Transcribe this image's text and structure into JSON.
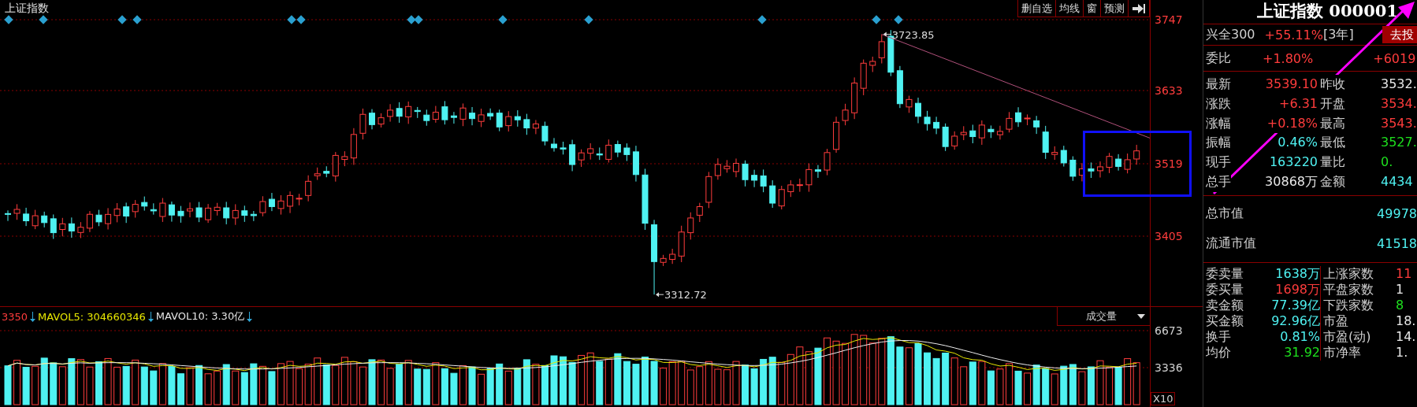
{
  "chart_title": "上证指数",
  "toolbar": [
    {
      "label": "删自选"
    },
    {
      "label": "均线"
    },
    {
      "label": "窗"
    },
    {
      "label": "预测"
    }
  ],
  "price_axis": [
    "3747",
    "3633",
    "3519",
    "3405"
  ],
  "annotations": {
    "high": "3723.85",
    "low": "3312.72"
  },
  "volume": {
    "indicators": [
      {
        "text": "3350",
        "color": "#ff3c3c"
      },
      {
        "text": "MAVOL5: 304660346",
        "color": "#e8e800"
      },
      {
        "text": "MAVOL10: 3.30亿",
        "color": "#e6e6e6"
      }
    ],
    "selector": "成交量",
    "axis": [
      "6673",
      "3336"
    ],
    "multiplier": "X10"
  },
  "quote": {
    "title": "上证指数 000001",
    "promo": {
      "name": "兴全300",
      "return": "+55.11%",
      "period": "[3年]",
      "button": "去投"
    },
    "ratio": {
      "label": "委比",
      "value": "+1.80%",
      "amount": "+6019"
    },
    "rows": [
      [
        {
          "label": "最新",
          "value": "3539.10",
          "color": "#ff3c3c"
        },
        {
          "label": "昨收",
          "value": "3532.",
          "color": "#e8e8e8"
        }
      ],
      [
        {
          "label": "涨跌",
          "value": "+6.31",
          "color": "#ff3c3c"
        },
        {
          "label": "开盘",
          "value": "3534.",
          "color": "#ff3c3c"
        }
      ],
      [
        {
          "label": "涨幅",
          "value": "+0.18%",
          "color": "#ff3c3c"
        },
        {
          "label": "最高",
          "value": "3543.",
          "color": "#ff3c3c"
        }
      ],
      [
        {
          "label": "振幅",
          "value": "0.46%",
          "color": "#4ff2f2"
        },
        {
          "label": "最低",
          "value": "3527.",
          "color": "#1ee01e"
        }
      ],
      [
        {
          "label": "现手",
          "value": "163220",
          "color": "#4ff2f2"
        },
        {
          "label": "量比",
          "value": "0.",
          "color": "#1ee01e"
        }
      ],
      [
        {
          "label": "总手",
          "value": "30868万",
          "color": "#e8e8e8"
        },
        {
          "label": "金额",
          "value": "4434",
          "color": "#4ff2f2"
        }
      ]
    ],
    "caps": [
      {
        "label": "总市值",
        "value": "49978"
      },
      {
        "label": "流通市值",
        "value": "41518"
      }
    ],
    "depth": [
      [
        {
          "label": "委卖量",
          "value": "1638万",
          "color": "#4ff2f2"
        },
        {
          "label": "上涨家数",
          "value": "11",
          "color": "#ff3c3c"
        }
      ],
      [
        {
          "label": "委买量",
          "value": "1698万",
          "color": "#ff3c3c"
        },
        {
          "label": "平盘家数",
          "value": "1",
          "color": "#e8e8e8"
        }
      ],
      [
        {
          "label": "卖金额",
          "value": "77.39亿",
          "color": "#4ff2f2"
        },
        {
          "label": "下跌家数",
          "value": "8",
          "color": "#1ee01e"
        }
      ],
      [
        {
          "label": "买金额",
          "value": "92.96亿",
          "color": "#4ff2f2"
        },
        {
          "label": "市盈",
          "value": "18.",
          "color": "#e8e8e8"
        }
      ],
      [
        {
          "label": "换手",
          "value": "0.81%",
          "color": "#4ff2f2"
        },
        {
          "label": "市盈(动)",
          "value": "14.",
          "color": "#e8e8e8"
        }
      ],
      [
        {
          "label": "均价",
          "value": "31.92",
          "color": "#1ee01e"
        },
        {
          "label": "市净率",
          "value": "1.",
          "color": "#e8e8e8"
        }
      ]
    ]
  }
}
